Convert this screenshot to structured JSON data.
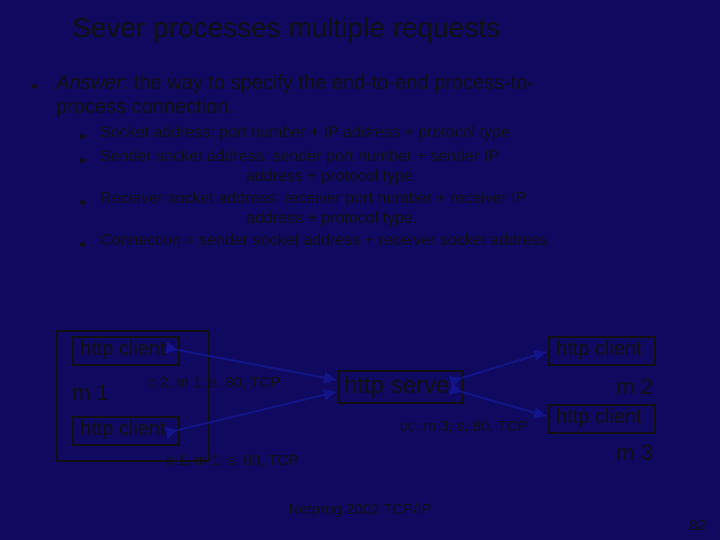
{
  "title": "Sever processes multiple requests",
  "answer": {
    "lead_italic": "Answer",
    "lead_rest": ":  the way to specify the end-to-end process-to-",
    "line2": "process connection."
  },
  "subs": {
    "a": "Socket address: port number + IP address + protocol type",
    "b1": "Sender socket address: sender port number + sender IP",
    "b2": "address +  protocol type",
    "c1": "Receiver socket address: receiver port number + receiver IP",
    "c2": "address +  protocol type.",
    "d": "Connection = sender socket address + receiver socket address"
  },
  "diagram": {
    "client_tl": "http client",
    "client_bl": "http client",
    "client_tr": "http client",
    "client_br": "http client",
    "server": "http server",
    "m1": "m 1",
    "m2": "m 2",
    "m3": "m 3",
    "conn1": "c 2, m 1;  s, 80, TCP",
    "conn2": "c 1, m 1;  s, 80, TCP",
    "conn3": "cc, m 3;  s, 80, TCP"
  },
  "footer": "Netprog 2002  TCP/IP",
  "page": "82"
}
